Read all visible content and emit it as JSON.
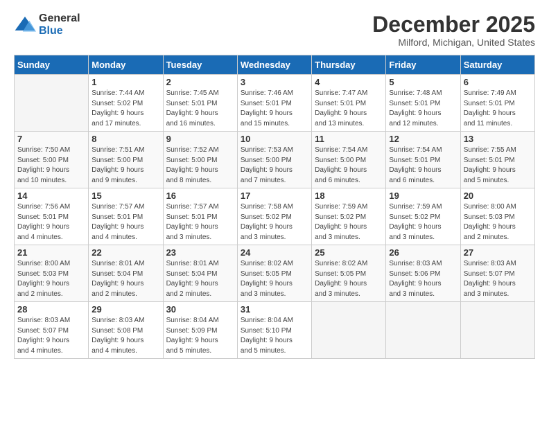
{
  "logo": {
    "general": "General",
    "blue": "Blue"
  },
  "title": "December 2025",
  "location": "Milford, Michigan, United States",
  "days_of_week": [
    "Sunday",
    "Monday",
    "Tuesday",
    "Wednesday",
    "Thursday",
    "Friday",
    "Saturday"
  ],
  "weeks": [
    [
      {
        "day": "",
        "sunrise": "",
        "sunset": "",
        "daylight": ""
      },
      {
        "day": "1",
        "sunrise": "Sunrise: 7:44 AM",
        "sunset": "Sunset: 5:02 PM",
        "daylight": "Daylight: 9 hours and 17 minutes."
      },
      {
        "day": "2",
        "sunrise": "Sunrise: 7:45 AM",
        "sunset": "Sunset: 5:01 PM",
        "daylight": "Daylight: 9 hours and 16 minutes."
      },
      {
        "day": "3",
        "sunrise": "Sunrise: 7:46 AM",
        "sunset": "Sunset: 5:01 PM",
        "daylight": "Daylight: 9 hours and 15 minutes."
      },
      {
        "day": "4",
        "sunrise": "Sunrise: 7:47 AM",
        "sunset": "Sunset: 5:01 PM",
        "daylight": "Daylight: 9 hours and 13 minutes."
      },
      {
        "day": "5",
        "sunrise": "Sunrise: 7:48 AM",
        "sunset": "Sunset: 5:01 PM",
        "daylight": "Daylight: 9 hours and 12 minutes."
      },
      {
        "day": "6",
        "sunrise": "Sunrise: 7:49 AM",
        "sunset": "Sunset: 5:01 PM",
        "daylight": "Daylight: 9 hours and 11 minutes."
      }
    ],
    [
      {
        "day": "7",
        "sunrise": "Sunrise: 7:50 AM",
        "sunset": "Sunset: 5:00 PM",
        "daylight": "Daylight: 9 hours and 10 minutes."
      },
      {
        "day": "8",
        "sunrise": "Sunrise: 7:51 AM",
        "sunset": "Sunset: 5:00 PM",
        "daylight": "Daylight: 9 hours and 9 minutes."
      },
      {
        "day": "9",
        "sunrise": "Sunrise: 7:52 AM",
        "sunset": "Sunset: 5:00 PM",
        "daylight": "Daylight: 9 hours and 8 minutes."
      },
      {
        "day": "10",
        "sunrise": "Sunrise: 7:53 AM",
        "sunset": "Sunset: 5:00 PM",
        "daylight": "Daylight: 9 hours and 7 minutes."
      },
      {
        "day": "11",
        "sunrise": "Sunrise: 7:54 AM",
        "sunset": "Sunset: 5:00 PM",
        "daylight": "Daylight: 9 hours and 6 minutes."
      },
      {
        "day": "12",
        "sunrise": "Sunrise: 7:54 AM",
        "sunset": "Sunset: 5:01 PM",
        "daylight": "Daylight: 9 hours and 6 minutes."
      },
      {
        "day": "13",
        "sunrise": "Sunrise: 7:55 AM",
        "sunset": "Sunset: 5:01 PM",
        "daylight": "Daylight: 9 hours and 5 minutes."
      }
    ],
    [
      {
        "day": "14",
        "sunrise": "Sunrise: 7:56 AM",
        "sunset": "Sunset: 5:01 PM",
        "daylight": "Daylight: 9 hours and 4 minutes."
      },
      {
        "day": "15",
        "sunrise": "Sunrise: 7:57 AM",
        "sunset": "Sunset: 5:01 PM",
        "daylight": "Daylight: 9 hours and 4 minutes."
      },
      {
        "day": "16",
        "sunrise": "Sunrise: 7:57 AM",
        "sunset": "Sunset: 5:01 PM",
        "daylight": "Daylight: 9 hours and 3 minutes."
      },
      {
        "day": "17",
        "sunrise": "Sunrise: 7:58 AM",
        "sunset": "Sunset: 5:02 PM",
        "daylight": "Daylight: 9 hours and 3 minutes."
      },
      {
        "day": "18",
        "sunrise": "Sunrise: 7:59 AM",
        "sunset": "Sunset: 5:02 PM",
        "daylight": "Daylight: 9 hours and 3 minutes."
      },
      {
        "day": "19",
        "sunrise": "Sunrise: 7:59 AM",
        "sunset": "Sunset: 5:02 PM",
        "daylight": "Daylight: 9 hours and 3 minutes."
      },
      {
        "day": "20",
        "sunrise": "Sunrise: 8:00 AM",
        "sunset": "Sunset: 5:03 PM",
        "daylight": "Daylight: 9 hours and 2 minutes."
      }
    ],
    [
      {
        "day": "21",
        "sunrise": "Sunrise: 8:00 AM",
        "sunset": "Sunset: 5:03 PM",
        "daylight": "Daylight: 9 hours and 2 minutes."
      },
      {
        "day": "22",
        "sunrise": "Sunrise: 8:01 AM",
        "sunset": "Sunset: 5:04 PM",
        "daylight": "Daylight: 9 hours and 2 minutes."
      },
      {
        "day": "23",
        "sunrise": "Sunrise: 8:01 AM",
        "sunset": "Sunset: 5:04 PM",
        "daylight": "Daylight: 9 hours and 2 minutes."
      },
      {
        "day": "24",
        "sunrise": "Sunrise: 8:02 AM",
        "sunset": "Sunset: 5:05 PM",
        "daylight": "Daylight: 9 hours and 3 minutes."
      },
      {
        "day": "25",
        "sunrise": "Sunrise: 8:02 AM",
        "sunset": "Sunset: 5:05 PM",
        "daylight": "Daylight: 9 hours and 3 minutes."
      },
      {
        "day": "26",
        "sunrise": "Sunrise: 8:03 AM",
        "sunset": "Sunset: 5:06 PM",
        "daylight": "Daylight: 9 hours and 3 minutes."
      },
      {
        "day": "27",
        "sunrise": "Sunrise: 8:03 AM",
        "sunset": "Sunset: 5:07 PM",
        "daylight": "Daylight: 9 hours and 3 minutes."
      }
    ],
    [
      {
        "day": "28",
        "sunrise": "Sunrise: 8:03 AM",
        "sunset": "Sunset: 5:07 PM",
        "daylight": "Daylight: 9 hours and 4 minutes."
      },
      {
        "day": "29",
        "sunrise": "Sunrise: 8:03 AM",
        "sunset": "Sunset: 5:08 PM",
        "daylight": "Daylight: 9 hours and 4 minutes."
      },
      {
        "day": "30",
        "sunrise": "Sunrise: 8:04 AM",
        "sunset": "Sunset: 5:09 PM",
        "daylight": "Daylight: 9 hours and 5 minutes."
      },
      {
        "day": "31",
        "sunrise": "Sunrise: 8:04 AM",
        "sunset": "Sunset: 5:10 PM",
        "daylight": "Daylight: 9 hours and 5 minutes."
      },
      {
        "day": "",
        "sunrise": "",
        "sunset": "",
        "daylight": ""
      },
      {
        "day": "",
        "sunrise": "",
        "sunset": "",
        "daylight": ""
      },
      {
        "day": "",
        "sunrise": "",
        "sunset": "",
        "daylight": ""
      }
    ]
  ]
}
